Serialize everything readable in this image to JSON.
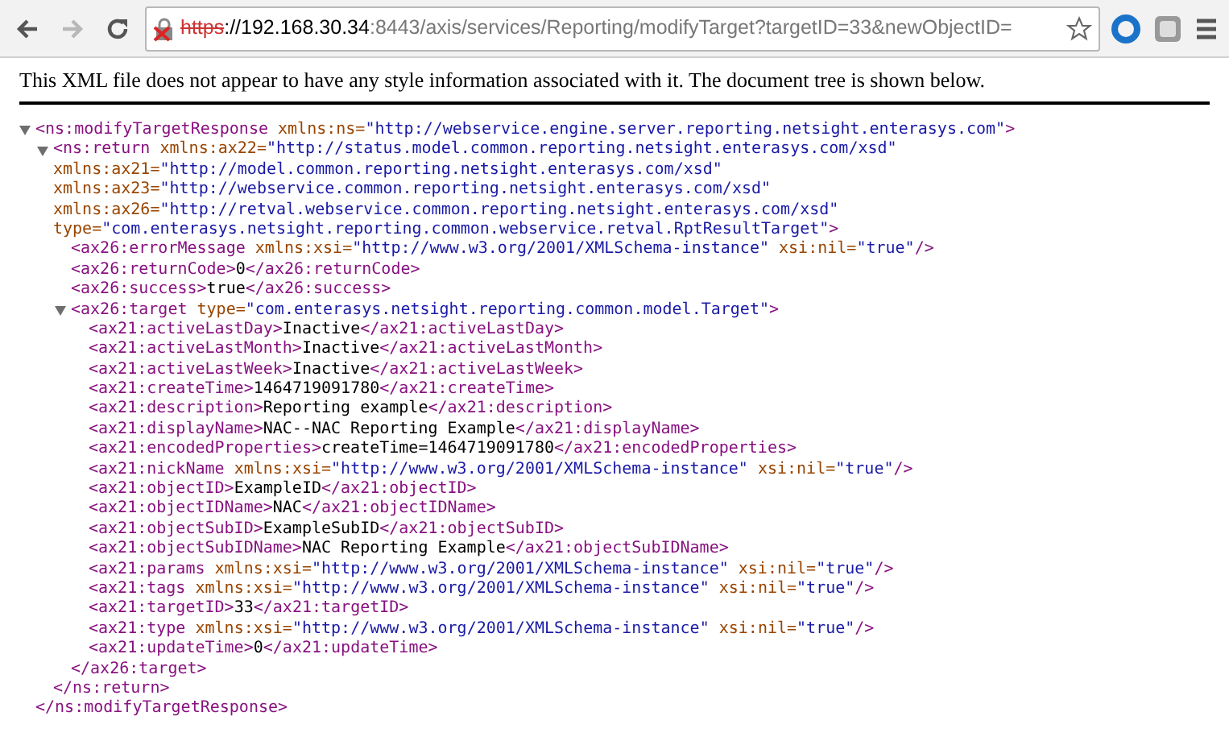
{
  "browser": {
    "back": {
      "disabled": false
    },
    "forward": {
      "disabled": true
    },
    "secure": false,
    "url": {
      "scheme": "https",
      "host": "://192.168.30.34",
      "rest": ":8443/axis/services/Reporting/modifyTarget?targetID=33&newObjectID="
    }
  },
  "info": "This XML file does not appear to have any style information associated with it. The document tree is shown below.",
  "xml_tree": [
    {
      "expanded": true,
      "lines": [
        [
          {
            "kind": "tag",
            "text": "<ns:modifyTargetResponse"
          },
          {
            "kind": "attr",
            "text": " xmlns:ns="
          },
          {
            "kind": "value",
            "text": "\"http://webservice.engine.server.reporting.netsight.enterasys.com\""
          },
          {
            "kind": "tag",
            "text": ">"
          }
        ]
      ],
      "close": [
        {
          "kind": "tag",
          "text": "</ns:modifyTargetResponse>"
        }
      ],
      "children": [
        {
          "expanded": true,
          "lines": [
            [
              {
                "kind": "tag",
                "text": "<ns:return"
              },
              {
                "kind": "attr",
                "text": " xmlns:ax22="
              },
              {
                "kind": "value",
                "text": "\"http://status.model.common.reporting.netsight.enterasys.com/xsd\""
              }
            ],
            [
              {
                "kind": "attr",
                "text": "xmlns:ax21="
              },
              {
                "kind": "value",
                "text": "\"http://model.common.reporting.netsight.enterasys.com/xsd\""
              }
            ],
            [
              {
                "kind": "attr",
                "text": "xmlns:ax23="
              },
              {
                "kind": "value",
                "text": "\"http://webservice.common.reporting.netsight.enterasys.com/xsd\""
              }
            ],
            [
              {
                "kind": "attr",
                "text": "xmlns:ax26="
              },
              {
                "kind": "value",
                "text": "\"http://retval.webservice.common.reporting.netsight.enterasys.com/xsd\""
              }
            ],
            [
              {
                "kind": "attr",
                "text": "type="
              },
              {
                "kind": "value",
                "text": "\"com.enterasys.netsight.reporting.common.webservice.retval.RptResultTarget\""
              },
              {
                "kind": "tag",
                "text": ">"
              }
            ]
          ],
          "close": [
            {
              "kind": "tag",
              "text": "</ns:return>"
            }
          ],
          "children": [
            {
              "lines": [
                [
                  {
                    "kind": "tag",
                    "text": "<ax26:errorMessage"
                  },
                  {
                    "kind": "attr",
                    "text": " xmlns:xsi="
                  },
                  {
                    "kind": "value",
                    "text": "\"http://www.w3.org/2001/XMLSchema-instance\""
                  },
                  {
                    "kind": "attr",
                    "text": " xsi:nil="
                  },
                  {
                    "kind": "value",
                    "text": "\"true\""
                  },
                  {
                    "kind": "tag",
                    "text": "/>"
                  }
                ]
              ]
            },
            {
              "lines": [
                [
                  {
                    "kind": "tag",
                    "text": "<ax26:returnCode>"
                  },
                  {
                    "kind": "text",
                    "text": "0"
                  },
                  {
                    "kind": "tag",
                    "text": "</ax26:returnCode>"
                  }
                ]
              ]
            },
            {
              "lines": [
                [
                  {
                    "kind": "tag",
                    "text": "<ax26:success>"
                  },
                  {
                    "kind": "text",
                    "text": "true"
                  },
                  {
                    "kind": "tag",
                    "text": "</ax26:success>"
                  }
                ]
              ]
            },
            {
              "expanded": true,
              "lines": [
                [
                  {
                    "kind": "tag",
                    "text": "<ax26:target"
                  },
                  {
                    "kind": "attr",
                    "text": " type="
                  },
                  {
                    "kind": "value",
                    "text": "\"com.enterasys.netsight.reporting.common.model.Target\""
                  },
                  {
                    "kind": "tag",
                    "text": ">"
                  }
                ]
              ],
              "close": [
                {
                  "kind": "tag",
                  "text": "</ax26:target>"
                }
              ],
              "children": [
                {
                  "lines": [
                    [
                      {
                        "kind": "tag",
                        "text": "<ax21:activeLastDay>"
                      },
                      {
                        "kind": "text",
                        "text": "Inactive"
                      },
                      {
                        "kind": "tag",
                        "text": "</ax21:activeLastDay>"
                      }
                    ]
                  ]
                },
                {
                  "lines": [
                    [
                      {
                        "kind": "tag",
                        "text": "<ax21:activeLastMonth>"
                      },
                      {
                        "kind": "text",
                        "text": "Inactive"
                      },
                      {
                        "kind": "tag",
                        "text": "</ax21:activeLastMonth>"
                      }
                    ]
                  ]
                },
                {
                  "lines": [
                    [
                      {
                        "kind": "tag",
                        "text": "<ax21:activeLastWeek>"
                      },
                      {
                        "kind": "text",
                        "text": "Inactive"
                      },
                      {
                        "kind": "tag",
                        "text": "</ax21:activeLastWeek>"
                      }
                    ]
                  ]
                },
                {
                  "lines": [
                    [
                      {
                        "kind": "tag",
                        "text": "<ax21:createTime>"
                      },
                      {
                        "kind": "text",
                        "text": "1464719091780"
                      },
                      {
                        "kind": "tag",
                        "text": "</ax21:createTime>"
                      }
                    ]
                  ]
                },
                {
                  "lines": [
                    [
                      {
                        "kind": "tag",
                        "text": "<ax21:description>"
                      },
                      {
                        "kind": "text",
                        "text": "Reporting example"
                      },
                      {
                        "kind": "tag",
                        "text": "</ax21:description>"
                      }
                    ]
                  ]
                },
                {
                  "lines": [
                    [
                      {
                        "kind": "tag",
                        "text": "<ax21:displayName>"
                      },
                      {
                        "kind": "text",
                        "text": "NAC--NAC Reporting Example"
                      },
                      {
                        "kind": "tag",
                        "text": "</ax21:displayName>"
                      }
                    ]
                  ]
                },
                {
                  "lines": [
                    [
                      {
                        "kind": "tag",
                        "text": "<ax21:encodedProperties>"
                      },
                      {
                        "kind": "text",
                        "text": "createTime=1464719091780"
                      },
                      {
                        "kind": "tag",
                        "text": "</ax21:encodedProperties>"
                      }
                    ]
                  ]
                },
                {
                  "lines": [
                    [
                      {
                        "kind": "tag",
                        "text": "<ax21:nickName"
                      },
                      {
                        "kind": "attr",
                        "text": " xmlns:xsi="
                      },
                      {
                        "kind": "value",
                        "text": "\"http://www.w3.org/2001/XMLSchema-instance\""
                      },
                      {
                        "kind": "attr",
                        "text": " xsi:nil="
                      },
                      {
                        "kind": "value",
                        "text": "\"true\""
                      },
                      {
                        "kind": "tag",
                        "text": "/>"
                      }
                    ]
                  ]
                },
                {
                  "lines": [
                    [
                      {
                        "kind": "tag",
                        "text": "<ax21:objectID>"
                      },
                      {
                        "kind": "text",
                        "text": "ExampleID"
                      },
                      {
                        "kind": "tag",
                        "text": "</ax21:objectID>"
                      }
                    ]
                  ]
                },
                {
                  "lines": [
                    [
                      {
                        "kind": "tag",
                        "text": "<ax21:objectIDName>"
                      },
                      {
                        "kind": "text",
                        "text": "NAC"
                      },
                      {
                        "kind": "tag",
                        "text": "</ax21:objectIDName>"
                      }
                    ]
                  ]
                },
                {
                  "lines": [
                    [
                      {
                        "kind": "tag",
                        "text": "<ax21:objectSubID>"
                      },
                      {
                        "kind": "text",
                        "text": "ExampleSubID"
                      },
                      {
                        "kind": "tag",
                        "text": "</ax21:objectSubID>"
                      }
                    ]
                  ]
                },
                {
                  "lines": [
                    [
                      {
                        "kind": "tag",
                        "text": "<ax21:objectSubIDName>"
                      },
                      {
                        "kind": "text",
                        "text": "NAC Reporting Example"
                      },
                      {
                        "kind": "tag",
                        "text": "</ax21:objectSubIDName>"
                      }
                    ]
                  ]
                },
                {
                  "lines": [
                    [
                      {
                        "kind": "tag",
                        "text": "<ax21:params"
                      },
                      {
                        "kind": "attr",
                        "text": " xmlns:xsi="
                      },
                      {
                        "kind": "value",
                        "text": "\"http://www.w3.org/2001/XMLSchema-instance\""
                      },
                      {
                        "kind": "attr",
                        "text": " xsi:nil="
                      },
                      {
                        "kind": "value",
                        "text": "\"true\""
                      },
                      {
                        "kind": "tag",
                        "text": "/>"
                      }
                    ]
                  ]
                },
                {
                  "lines": [
                    [
                      {
                        "kind": "tag",
                        "text": "<ax21:tags"
                      },
                      {
                        "kind": "attr",
                        "text": " xmlns:xsi="
                      },
                      {
                        "kind": "value",
                        "text": "\"http://www.w3.org/2001/XMLSchema-instance\""
                      },
                      {
                        "kind": "attr",
                        "text": " xsi:nil="
                      },
                      {
                        "kind": "value",
                        "text": "\"true\""
                      },
                      {
                        "kind": "tag",
                        "text": "/>"
                      }
                    ]
                  ]
                },
                {
                  "lines": [
                    [
                      {
                        "kind": "tag",
                        "text": "<ax21:targetID>"
                      },
                      {
                        "kind": "text",
                        "text": "33"
                      },
                      {
                        "kind": "tag",
                        "text": "</ax21:targetID>"
                      }
                    ]
                  ]
                },
                {
                  "lines": [
                    [
                      {
                        "kind": "tag",
                        "text": "<ax21:type"
                      },
                      {
                        "kind": "attr",
                        "text": " xmlns:xsi="
                      },
                      {
                        "kind": "value",
                        "text": "\"http://www.w3.org/2001/XMLSchema-instance\""
                      },
                      {
                        "kind": "attr",
                        "text": " xsi:nil="
                      },
                      {
                        "kind": "value",
                        "text": "\"true\""
                      },
                      {
                        "kind": "tag",
                        "text": "/>"
                      }
                    ]
                  ]
                },
                {
                  "lines": [
                    [
                      {
                        "kind": "tag",
                        "text": "<ax21:updateTime>"
                      },
                      {
                        "kind": "text",
                        "text": "0"
                      },
                      {
                        "kind": "tag",
                        "text": "</ax21:updateTime>"
                      }
                    ]
                  ]
                }
              ]
            }
          ]
        }
      ]
    }
  ]
}
